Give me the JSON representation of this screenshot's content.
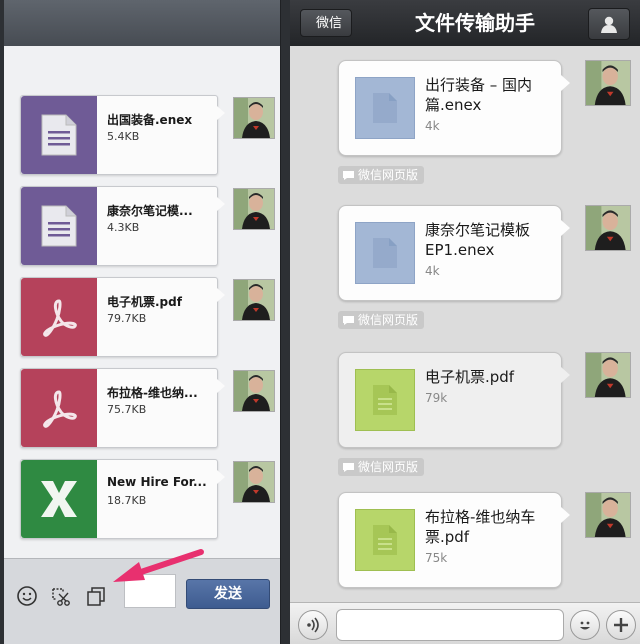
{
  "left_panel": {
    "files": [
      {
        "name": "出国装备.enex",
        "size": "5.4KB",
        "type": "document",
        "color": "#6f5b96"
      },
      {
        "name": "康奈尔笔记模...",
        "size": "4.3KB",
        "type": "document",
        "color": "#6f5b96"
      },
      {
        "name": "电子机票.pdf",
        "size": "79.7KB",
        "type": "pdf",
        "color": "#b5425b"
      },
      {
        "name": "布拉格-维也纳...",
        "size": "75.7KB",
        "type": "pdf",
        "color": "#b5425b"
      },
      {
        "name": "New Hire For...",
        "size": "18.7KB",
        "type": "excel",
        "color": "#2f8a42"
      }
    ],
    "toolbar": {
      "emoji_icon": "smiley-icon",
      "screenshot_icon": "scissors-icon",
      "file_icon": "copy-file-icon",
      "send_label": "发送"
    },
    "annotation_arrow_color": "#e8306f"
  },
  "right_panel": {
    "nav": {
      "back_label": "微信",
      "title": "文件传输助手",
      "profile_icon": "person-icon"
    },
    "messages": [
      {
        "name": "出行装备 – 国内篇.enex",
        "size": "4k",
        "thumb": "blue",
        "tag": "微信网页版"
      },
      {
        "name": "康奈尔笔记模板EP1.enex",
        "size": "4k",
        "thumb": "blue",
        "tag": "微信网页版"
      },
      {
        "name": "电子机票.pdf",
        "size": "79k",
        "thumb": "lime",
        "tag": "微信网页版"
      },
      {
        "name": "布拉格-维也纳车票.pdf",
        "size": "75k",
        "thumb": "lime"
      }
    ],
    "bottom": {
      "voice_icon": "voice-icon",
      "emoji_icon": "smiley-icon",
      "plus_icon": "plus-icon"
    }
  }
}
